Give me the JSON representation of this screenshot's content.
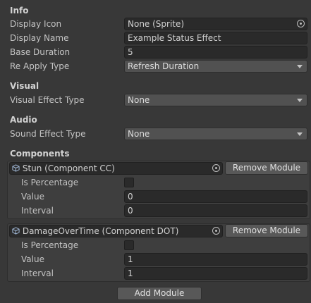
{
  "sections": {
    "info": "Info",
    "visual": "Visual",
    "audio": "Audio",
    "components": "Components"
  },
  "info": {
    "display_icon_label": "Display Icon",
    "display_icon_value": "None (Sprite)",
    "display_name_label": "Display Name",
    "display_name_value": "Example Status Effect",
    "base_duration_label": "Base Duration",
    "base_duration_value": "5",
    "reapply_type_label": "Re Apply Type",
    "reapply_type_value": "Refresh Duration"
  },
  "visual": {
    "effect_type_label": "Visual Effect Type",
    "effect_type_value": "None"
  },
  "audio": {
    "sound_type_label": "Sound Effect Type",
    "sound_type_value": "None"
  },
  "modules": [
    {
      "name": "Stun (Component CC)",
      "remove_label": "Remove Module",
      "is_percentage_label": "Is Percentage",
      "is_percentage_checked": false,
      "value_label": "Value",
      "value": "0",
      "interval_label": "Interval",
      "interval": "0"
    },
    {
      "name": "DamageOverTime (Component DOT)",
      "remove_label": "Remove Module",
      "is_percentage_label": "Is Percentage",
      "is_percentage_checked": false,
      "value_label": "Value",
      "value": "1",
      "interval_label": "Interval",
      "interval": "1"
    }
  ],
  "add_module_label": "Add Module",
  "icons": {
    "object_picker": "target-icon",
    "dropdown": "chevron-down-icon",
    "component": "cube-icon"
  }
}
